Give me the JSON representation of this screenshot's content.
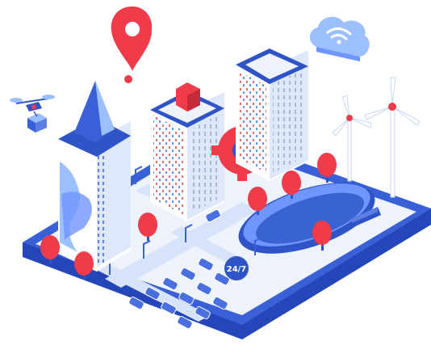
{
  "scene": {
    "badge_text": "24/7",
    "icons": [
      "location-pin-icon",
      "cloud-wifi-icon",
      "drone-icon",
      "gear-icon",
      "wind-turbine-icon",
      "bench-icon"
    ]
  },
  "colors": {
    "platform_blue": "#2e54c8",
    "platform_top": "#eef2fb",
    "accent_red": "#ef3b4a",
    "light_blue": "#9cc0ff",
    "pool_blue": "#3a63d2",
    "white": "#ffffff"
  }
}
